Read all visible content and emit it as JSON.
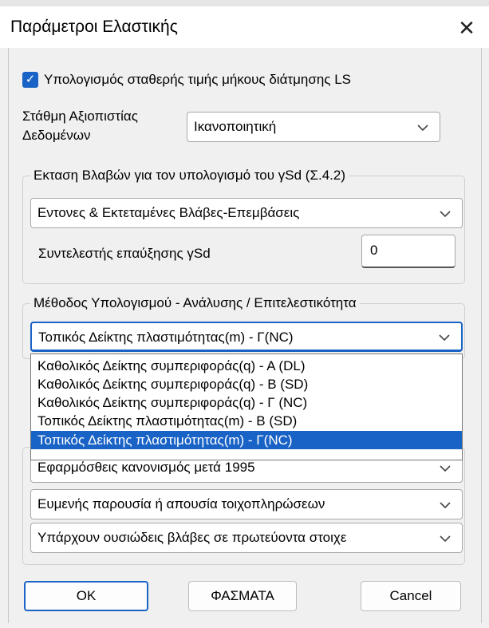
{
  "window": {
    "title": "Παράμετροι Ελαστικής",
    "close_glyph": "✕"
  },
  "options": {
    "ls_checkbox_label": "Υπολογισμός σταθερής τιμής μήκους διάτμησης LS",
    "ls_checked": true,
    "reliability_label_line1": "Στάθμη Αξιοπιστίας",
    "reliability_label_line2": "Δεδομένων",
    "reliability_value": "Ικανοποιητική"
  },
  "damage_group": {
    "legend": "Εκταση Βλαβών για τον υπολογισμό του γSd (Σ.4.2)",
    "damage_value": "Εντονες & Εκτεταμένες Βλάβες-Επεμβάσεις",
    "factor_label": "Συντελεστής επαύξησης γSd",
    "factor_value": "0"
  },
  "method_group": {
    "legend": "Μέθοδος Υπολογισμού - Ανάλυσης /  Επιτελεστικότητα",
    "selected_value": "Τοπικός Δείκτης πλαστιμότητας(m) - Γ(NC)",
    "dropdown_options": [
      "Καθολικός Δείκτης συμπεριφοράς(q) - Α (DL)",
      "Καθολικός Δείκτης συμπεριφοράς(q) - Β (SD)",
      "Καθολικός Δείκτης συμπεριφοράς(q) - Γ (NC)",
      "Τοπικός Δείκτης πλαστιμότητας(m) - Β (SD)",
      "Τοπικός Δείκτης πλαστιμότητας(m) - Γ(NC)"
    ],
    "highlighted_index": 4
  },
  "lower_group": {
    "regulation_value": "Εφαρμόσθεις κανονισμός μετά 1995",
    "infill_value": "Ευμενής παρουσία ή απουσία τοιχοπληρώσεων",
    "damage_primary_value": "Υπάρχουν ουσιώδεις βλάβες σε πρωτεύοντα στοιχε"
  },
  "buttons": {
    "ok": "OK",
    "spectra": "ΦΑΣΜΑΤΑ",
    "cancel": "Cancel"
  },
  "colors": {
    "accent": "#1a63c6",
    "background": "#f0f0f0"
  },
  "icons": {
    "checkbox": "checkmark-icon",
    "chevron": "chevron-down-icon",
    "close": "close-icon"
  }
}
